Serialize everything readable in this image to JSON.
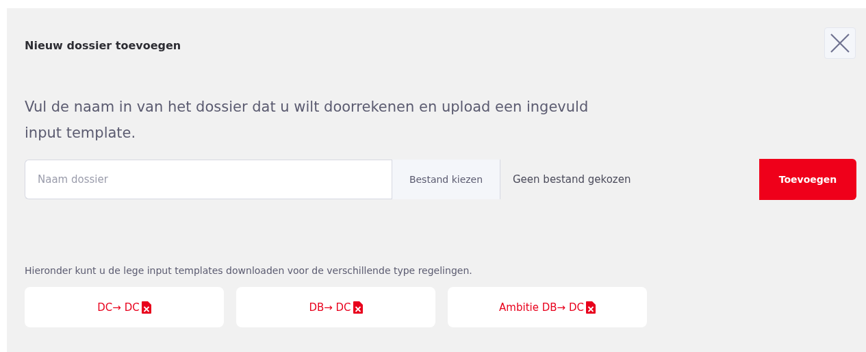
{
  "dialog": {
    "title": "Nieuw dossier toevoegen",
    "intro": "Vul de naam in van het dossier dat u wilt doorrekenen en upload een ingevuld input template."
  },
  "form": {
    "name_field": {
      "placeholder": "Naam dossier"
    },
    "file_button": "Bestand kiezen",
    "file_name": "Geen bestand gekozen",
    "submit": "Toevoegen"
  },
  "templates": {
    "hint": "Hieronder kunt u de lege input templates downloaden voor de verschillende type regelingen.",
    "buttons": [
      {
        "label": "DC→ DC"
      },
      {
        "label": "DB→ DC"
      },
      {
        "label": "Ambitie DB→ DC"
      }
    ]
  }
}
